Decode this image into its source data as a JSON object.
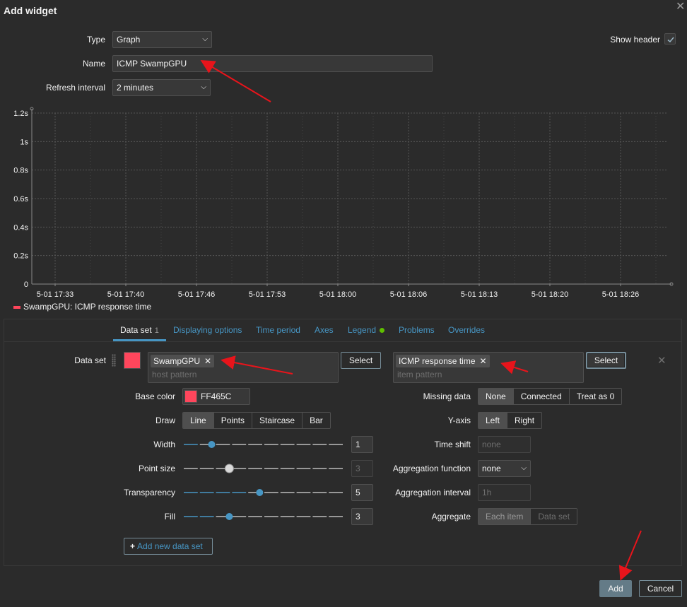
{
  "dialog": {
    "title": "Add widget"
  },
  "form": {
    "type_label": "Type",
    "type_value": "Graph",
    "name_label": "Name",
    "name_value": "ICMP SwampGPU",
    "refresh_label": "Refresh interval",
    "refresh_value": "2 minutes",
    "show_header_label": "Show header",
    "show_header_checked": true
  },
  "chart_data": {
    "type": "line",
    "yticks": [
      "1.2s",
      "1s",
      "0.8s",
      "0.6s",
      "0.4s",
      "0.2s",
      "0"
    ],
    "ylim": [
      0,
      1.2
    ],
    "xticks": [
      "5-01 17:33",
      "5-01 17:40",
      "5-01 17:46",
      "5-01 17:53",
      "5-01 18:00",
      "5-01 18:06",
      "5-01 18:13",
      "5-01 18:20",
      "5-01 18:26"
    ],
    "grid": true,
    "series": [
      {
        "name": "SwampGPU: ICMP response time",
        "color": "#FF465C",
        "values": []
      }
    ]
  },
  "tabs": [
    {
      "label": "Data set",
      "count": "1",
      "active": true
    },
    {
      "label": "Displaying options"
    },
    {
      "label": "Time period"
    },
    {
      "label": "Axes"
    },
    {
      "label": "Legend",
      "dot": true
    },
    {
      "label": "Problems"
    },
    {
      "label": "Overrides"
    }
  ],
  "dataset": {
    "label": "Data set",
    "host_chip": "SwampGPU",
    "host_placeholder": "host pattern",
    "item_chip": "ICMP response time",
    "item_placeholder": "item pattern",
    "select_label": "Select",
    "base_color_label": "Base color",
    "base_color_value": "FF465C",
    "draw_label": "Draw",
    "draw_options": [
      "Line",
      "Points",
      "Staircase",
      "Bar"
    ],
    "draw_selected": "Line",
    "width_label": "Width",
    "width_value": "1",
    "point_size_label": "Point size",
    "point_size_value": "3",
    "transparency_label": "Transparency",
    "transparency_value": "5",
    "fill_label": "Fill",
    "fill_value": "3",
    "missing_label": "Missing data",
    "missing_options": [
      "None",
      "Connected",
      "Treat as 0"
    ],
    "missing_selected": "None",
    "yaxis_label": "Y-axis",
    "yaxis_options": [
      "Left",
      "Right"
    ],
    "yaxis_selected": "Left",
    "timeshift_label": "Time shift",
    "timeshift_placeholder": "none",
    "aggfunc_label": "Aggregation function",
    "aggfunc_value": "none",
    "aggint_label": "Aggregation interval",
    "aggint_placeholder": "1h",
    "aggregate_label": "Aggregate",
    "aggregate_options": [
      "Each item",
      "Data set"
    ],
    "aggregate_selected": "Each item",
    "add_dataset_label": "Add new data set"
  },
  "footer": {
    "add_label": "Add",
    "cancel_label": "Cancel"
  }
}
